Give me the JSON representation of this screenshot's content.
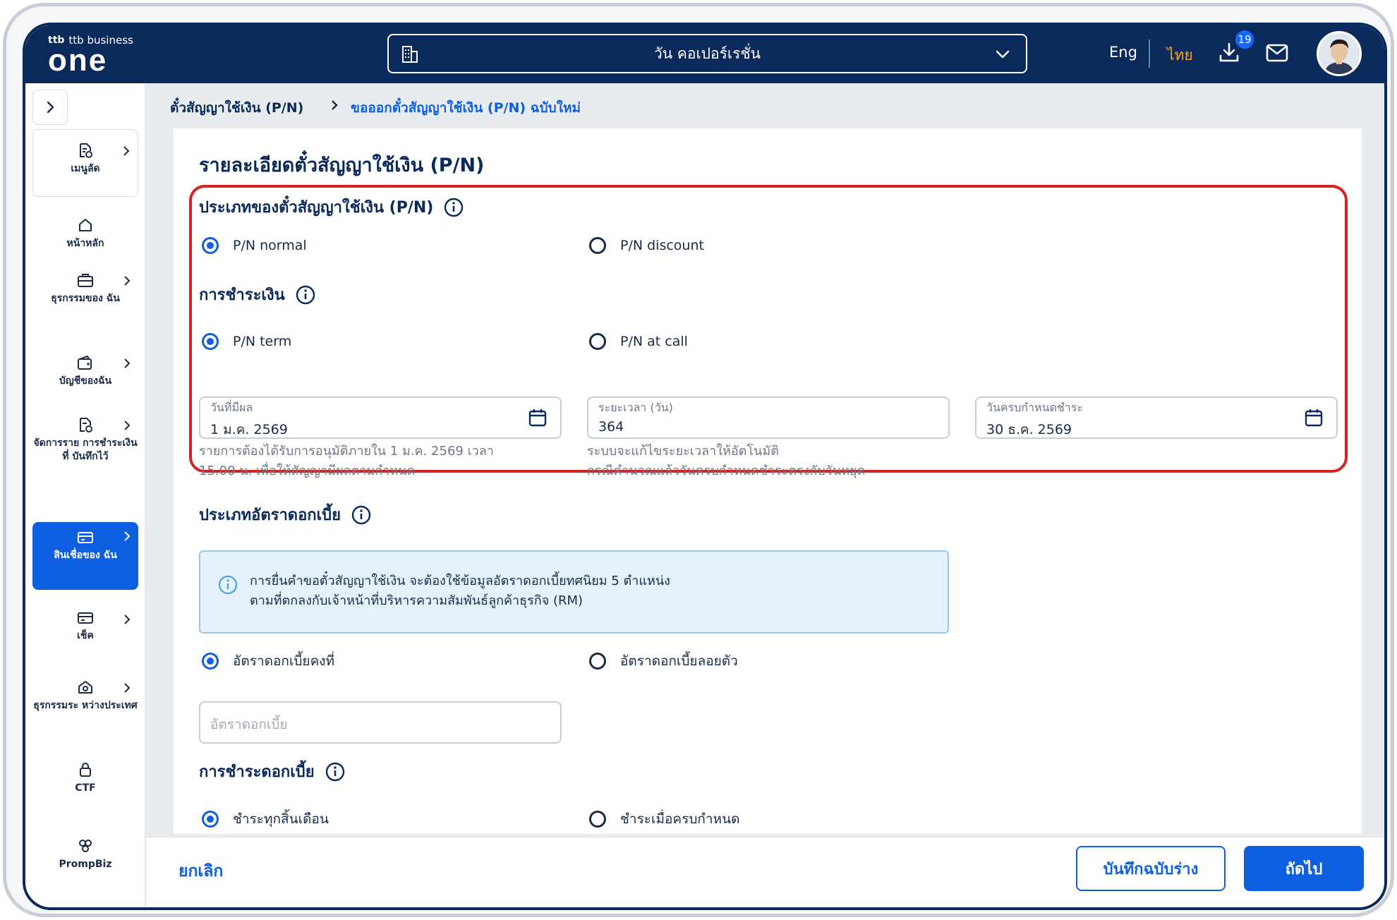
{
  "header": {
    "brand_small": "ttb business",
    "brand_main": "one",
    "company": "วัน คอเปอร์เรชั่น",
    "lang_en": "Eng",
    "lang_th": "ไทย",
    "download_badge": "19"
  },
  "sidebar": {
    "items": [
      {
        "label": "เมนูลัด"
      },
      {
        "label": "หน้าหลัก"
      },
      {
        "label": "ธุรกรรมของ ฉัน"
      },
      {
        "label": "บัญชีของฉัน"
      },
      {
        "label": "จัดการราย การชำระเงินที่ บันทึกไว้"
      },
      {
        "label": "สินเชื่อของ ฉัน"
      },
      {
        "label": "เช็ค"
      },
      {
        "label": "ธุรกรรมระ หว่างประเทศ"
      },
      {
        "label": "CTF"
      },
      {
        "label": "PrompBiz"
      }
    ]
  },
  "breadcrumb": {
    "parent": "ตั๋วสัญญาใช้เงิน (P/N)",
    "current": "ขอออกตั๋วสัญญาใช้เงิน (P/N) ฉบับใหม่"
  },
  "page": {
    "title": "รายละเอียดตั๋วสัญญาใช้เงิน (P/N)",
    "pn_type": {
      "title": "ประเภทของตั๋วสัญญาใช้เงิน (P/N)",
      "options": [
        "P/N normal",
        "P/N discount"
      ],
      "selected": "P/N normal"
    },
    "payment": {
      "title": "การชำระเงิน",
      "options": [
        "P/N term",
        "P/N at call"
      ],
      "selected": "P/N term"
    },
    "fields": {
      "effective_label": "วันที่มีผล",
      "effective_value": "1 ม.ค. 2569",
      "effective_help_1": "รายการต้องได้รับการอนุมัติภายใน 1 ม.ค. 2569 เวลา",
      "effective_help_2": "15.00 น. เพื่อให้สัญญามีผลตามกำหนด",
      "duration_label": "ระยะเวลา (วัน)",
      "duration_value": "364",
      "duration_help_1": "ระบบจะแก้ไขระยะเวลาให้อัตโนมัติ",
      "duration_help_2": "กรณีคำนวณแล้ววันครบกำหนดชำระตรงกับวันหยุด",
      "maturity_label": "วันครบกำหนดชำระ",
      "maturity_value": "30 ธ.ค. 2569"
    },
    "rate_type": {
      "title": "ประเภทอัตราดอกเบี้ย",
      "info_line_1": "การยื่นคำขอตั๋วสัญญาใช้เงิน จะต้องใช้ข้อมูลอัตราดอกเบี้ยทศนิยม 5 ตำแหน่ง",
      "info_line_2": "ตามที่ตกลงกับเจ้าหน้าที่บริหารความสัมพันธ์ลูกค้าธุรกิจ (RM)",
      "options": [
        "อัตราดอกเบี้ยคงที่",
        "อัตราดอกเบี้ยลอยตัว"
      ],
      "selected": "อัตราดอกเบี้ยคงที่",
      "rate_placeholder": "อัตราดอกเบี้ย"
    },
    "interest_payment": {
      "title": "การชำระดอกเบี้ย",
      "options": [
        "ชำระทุกสิ้นเดือน",
        "ชำระเมื่อครบกำหนด"
      ],
      "selected": "ชำระทุกสิ้นเดือน"
    }
  },
  "footer": {
    "cancel": "ยกเลิก",
    "save_draft": "บันทึกฉบับร่าง",
    "next": "ถัดไป"
  },
  "colors": {
    "navy": "#0a2a5b",
    "primary": "#0d5fe0",
    "highlight_border": "#d62222",
    "accent_orange": "#f5a623"
  }
}
